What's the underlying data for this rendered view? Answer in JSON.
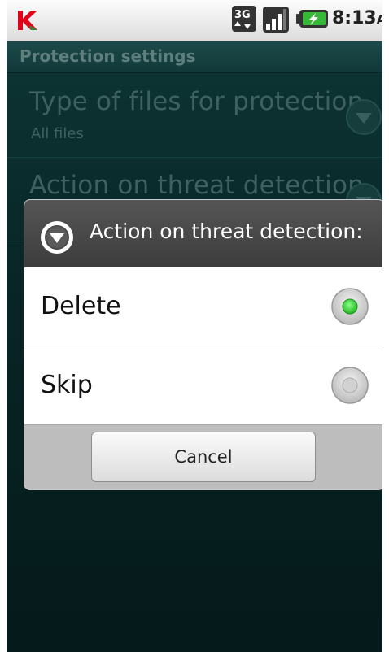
{
  "status_bar": {
    "network_type": "3G",
    "time": "8:13",
    "ampm": "AM",
    "icons": [
      "kaspersky-logo",
      "3g-data-icon",
      "signal-strength-icon",
      "battery-charging-icon"
    ]
  },
  "app": {
    "title": "Protection settings",
    "settings": [
      {
        "title": "Type of files for protection",
        "value": "All files"
      },
      {
        "title": "Action on threat detection",
        "value": ""
      }
    ]
  },
  "dialog": {
    "title": "Action on threat detection:",
    "options": [
      {
        "label": "Delete",
        "selected": true
      },
      {
        "label": "Skip",
        "selected": false
      }
    ],
    "cancel_label": "Cancel"
  },
  "colors": {
    "app_background": "#082424",
    "accent_radio": "#3fd43f",
    "kaspersky_red": "#e2001a"
  }
}
